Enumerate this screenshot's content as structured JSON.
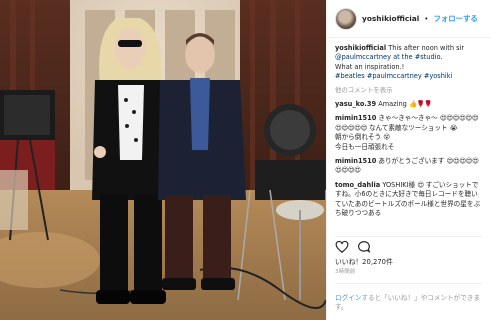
{
  "post": {
    "username": "yoshikiofficial",
    "dot": "•",
    "follow_label": "フォローする",
    "caption_user": "yoshikiofficial",
    "caption_text": "This after noon with sir",
    "caption_mention_studio": "@paulmccartney at the #studio.",
    "caption_line3": "What an inspiration.!",
    "caption_tags": "#beatles #paulmccartney #yoshiki",
    "more_comments": "他のコメントを表示",
    "comments": [
      {
        "user": "yasu_ko.39",
        "text": "Amazing",
        "emoji": "👍🌹🌹"
      },
      {
        "user": "mimin1510",
        "text": "きゃ〜きゃ〜きゃ〜",
        "emoji": "😍😍😍😍😍😍😍😍😍😍😍",
        "text2": "なんて素敵なツーショット",
        "emoji2": "😭",
        "text3": "朝から倒れそう",
        "emoji3": "😵",
        "text4": "今日も一日頑張れそ"
      },
      {
        "user": "mimin1510",
        "text": "ありがとうございます",
        "emoji": "😍😍😍😍😍😍😍😍😍"
      },
      {
        "user": "tomo_dahlia",
        "text": "YOSHIKI様",
        "emoji": "😍",
        "text2": "すごいショットですね。小6のときに大好きで毎日レコードを聴いていたあのビートルズのポール様と世界の星をぶち破りつつある"
      }
    ],
    "likes": "いいね！20,270件",
    "date": "3時間前",
    "login_link": "ログイン",
    "login_text": "すると「いいね！」やコメントができます。"
  },
  "icons": {
    "like": "heart-icon",
    "comment": "speech-bubble-icon",
    "save": "bookmark-icon"
  }
}
